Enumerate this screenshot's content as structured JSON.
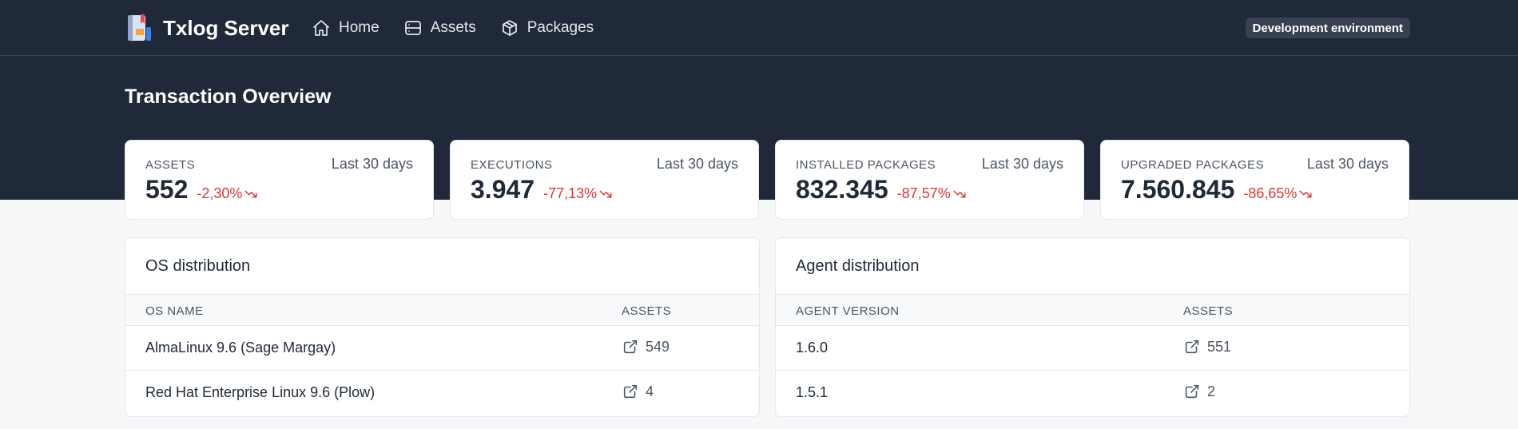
{
  "header": {
    "app_name": "Txlog Server",
    "nav": [
      {
        "label": "Home",
        "icon": "home-icon"
      },
      {
        "label": "Assets",
        "icon": "server-icon"
      },
      {
        "label": "Packages",
        "icon": "package-icon"
      }
    ],
    "env_badge": "Development environment"
  },
  "page": {
    "title": "Transaction Overview"
  },
  "stats": [
    {
      "label": "ASSETS",
      "period": "Last 30 days",
      "value": "552",
      "change": "-2,30%",
      "trend": "down"
    },
    {
      "label": "EXECUTIONS",
      "period": "Last 30 days",
      "value": "3.947",
      "change": "-77,13%",
      "trend": "down"
    },
    {
      "label": "INSTALLED PACKAGES",
      "period": "Last 30 days",
      "value": "832.345",
      "change": "-87,57%",
      "trend": "down"
    },
    {
      "label": "UPGRADED PACKAGES",
      "period": "Last 30 days",
      "value": "7.560.845",
      "change": "-86,65%",
      "trend": "down"
    }
  ],
  "os_panel": {
    "title": "OS distribution",
    "columns": [
      "OS NAME",
      "ASSETS"
    ],
    "rows": [
      {
        "name": "AlmaLinux 9.6 (Sage Margay)",
        "assets": "549"
      },
      {
        "name": "Red Hat Enterprise Linux 9.6 (Plow)",
        "assets": "4"
      }
    ]
  },
  "agent_panel": {
    "title": "Agent distribution",
    "columns": [
      "AGENT VERSION",
      "ASSETS"
    ],
    "rows": [
      {
        "version": "1.6.0",
        "assets": "551"
      },
      {
        "version": "1.5.1",
        "assets": "2"
      }
    ]
  },
  "colors": {
    "header_bg": "#202939",
    "negative_change": "#d63939",
    "page_bg": "#f6f7f9"
  }
}
